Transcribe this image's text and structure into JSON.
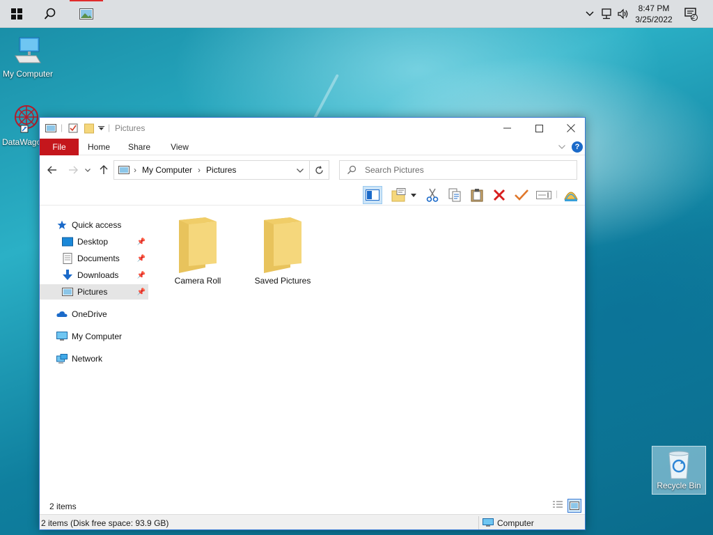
{
  "taskbar": {
    "clock_time": "8:47 PM",
    "clock_date": "3/25/2022",
    "notification_count": "2"
  },
  "desktop": {
    "icons": [
      {
        "label": "My Computer"
      },
      {
        "label": "DataWago"
      }
    ],
    "recycle_bin_label": "Recycle Bin"
  },
  "window": {
    "title": "Pictures",
    "ribbon_tabs": [
      "File",
      "Home",
      "Share",
      "View"
    ],
    "address": {
      "crumbs": [
        "My Computer",
        "Pictures"
      ]
    },
    "search": {
      "placeholder": "Search Pictures"
    },
    "nav": {
      "quick_access": "Quick access",
      "items": [
        {
          "label": "Desktop",
          "pinned": true
        },
        {
          "label": "Documents",
          "pinned": true
        },
        {
          "label": "Downloads",
          "pinned": true
        },
        {
          "label": "Pictures",
          "pinned": true,
          "selected": true
        }
      ],
      "onedrive": "OneDrive",
      "my_computer": "My Computer",
      "network": "Network"
    },
    "folders": [
      {
        "name": "Camera Roll"
      },
      {
        "name": "Saved Pictures"
      }
    ],
    "status": {
      "item_count": "2 items",
      "disk_info": "2 items (Disk free space: 93.9 GB)",
      "location": "Computer"
    }
  },
  "colors": {
    "file_tab": "#c4161c",
    "accent": "#3a7bd5",
    "folder": "#f5d77c"
  }
}
